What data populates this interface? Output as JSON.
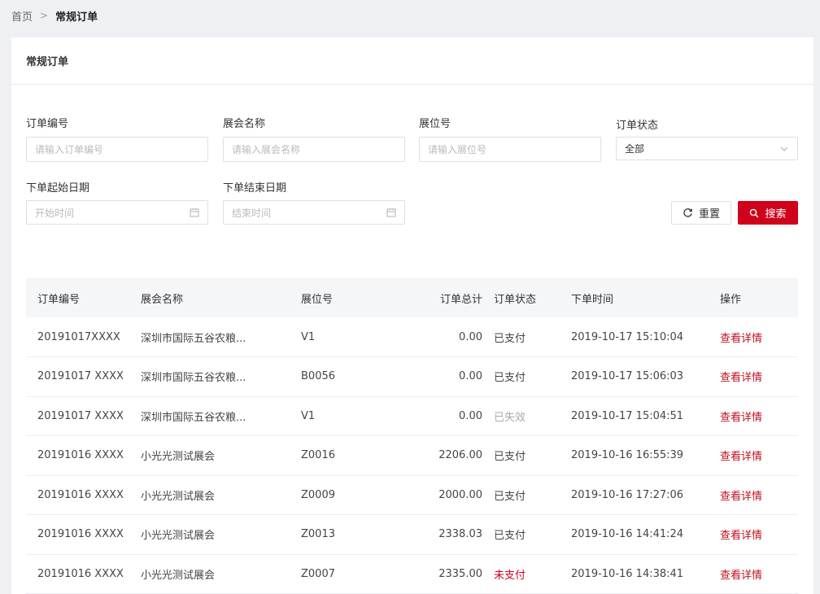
{
  "breadcrumb": {
    "home": "首页",
    "separator": ">",
    "current": "常规订单"
  },
  "card": {
    "title": "常规订单"
  },
  "filters": {
    "order_no": {
      "label": "订单编号",
      "placeholder": "请输入订单编号"
    },
    "expo_name": {
      "label": "展会名称",
      "placeholder": "请输入展会名称"
    },
    "booth_no": {
      "label": "展位号",
      "placeholder": "请输入展位号"
    },
    "order_status": {
      "label": "订单状态",
      "value": "全部"
    },
    "start_date": {
      "label": "下单起始日期",
      "placeholder": "开始时间"
    },
    "end_date": {
      "label": "下单结束日期",
      "placeholder": "结束时间"
    }
  },
  "buttons": {
    "reset": "重置",
    "search": "搜索"
  },
  "table": {
    "headers": [
      "订单编号",
      "展会名称",
      "展位号",
      "订单总计",
      "订单状态",
      "下单时间",
      "操作"
    ],
    "rows": [
      {
        "id": "20191017XXXX",
        "expo": "深圳市国际五谷农粮...",
        "booth": "V1",
        "total": "0.00",
        "status": "已支付",
        "status_type": "paid",
        "time": "2019-10-17 15:10:04",
        "action": "查看详情"
      },
      {
        "id": "20191017 XXXX",
        "expo": "深圳市国际五谷农粮...",
        "booth": "B0056",
        "total": "0.00",
        "status": "已支付",
        "status_type": "paid",
        "time": "2019-10-17 15:06:03",
        "action": "查看详情"
      },
      {
        "id": "20191017 XXXX",
        "expo": "深圳市国际五谷农粮...",
        "booth": "V1",
        "total": "0.00",
        "status": "已失效",
        "status_type": "expired",
        "time": "2019-10-17 15:04:51",
        "action": "查看详情"
      },
      {
        "id": "20191016 XXXX",
        "expo": "小光光测试展会",
        "booth": "Z0016",
        "total": "2206.00",
        "status": "已支付",
        "status_type": "paid",
        "time": "2019-10-16 16:55:39",
        "action": "查看详情"
      },
      {
        "id": "20191016 XXXX",
        "expo": "小光光测试展会",
        "booth": "Z0009",
        "total": "2000.00",
        "status": "已支付",
        "status_type": "paid",
        "time": "2019-10-16 17:27:06",
        "action": "查看详情"
      },
      {
        "id": "20191016 XXXX",
        "expo": "小光光测试展会",
        "booth": "Z0013",
        "total": "2338.03",
        "status": "已支付",
        "status_type": "paid",
        "time": "2019-10-16 14:41:24",
        "action": "查看详情"
      },
      {
        "id": "20191016 XXXX",
        "expo": "小光光测试展会",
        "booth": "Z0007",
        "total": "2335.00",
        "status": "未支付",
        "status_type": "unpaid",
        "time": "2019-10-16 14:38:41",
        "action": "查看详情"
      }
    ]
  },
  "colors": {
    "accent": "#d0021b",
    "page_bg": "#eef0f4",
    "expired": "#aaaaaa"
  },
  "icons": {
    "select_arrow": "chevron-down-icon",
    "date": "calendar-icon",
    "reset": "refresh-icon",
    "search": "search-icon"
  }
}
